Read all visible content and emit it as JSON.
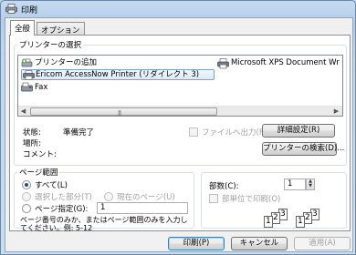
{
  "window": {
    "title": "印刷"
  },
  "tabs": [
    {
      "label": "全般"
    },
    {
      "label": "オプション"
    }
  ],
  "printer_group": {
    "label": "プリンターの選択",
    "items": [
      {
        "label": "プリンターの追加",
        "icon": "add-printer-icon"
      },
      {
        "label": "Microsoft XPS Document Wr",
        "icon": "printer-icon"
      },
      {
        "label": "Ericom AccessNow Printer (リダイレクト 3)",
        "icon": "printer-icon",
        "selected": true
      },
      {
        "label": "Fax",
        "icon": "fax-icon"
      }
    ]
  },
  "status": {
    "state_label": "状態:",
    "state_value": "準備完了",
    "location_label": "場所:",
    "comment_label": "コメント:"
  },
  "print_to_file": {
    "label": "ファイルへ出力(F)",
    "checked": false,
    "disabled": true
  },
  "buttons": {
    "preferences": "詳細設定(R)",
    "find_printer": "プリンターの検索(D)...",
    "print": "印刷(P)",
    "cancel": "キャンセル",
    "apply": "適用(A)"
  },
  "page_range": {
    "label": "ページ範囲",
    "all": "すべて(L)",
    "selection": "選択した部分(T)",
    "current_page": "現在のページ(U)",
    "pages": "ページ指定(G):",
    "pages_value": "1",
    "hint_line1": "ページ番号のみか、またはページ範囲のみを入力し",
    "hint_line2": "てください。例: 5-12"
  },
  "copies": {
    "label": "部数(C):",
    "value": "1",
    "collate": "部単位で印刷(O)",
    "collate_pages": [
      "1",
      "2",
      "3",
      "1",
      "2",
      "3"
    ]
  },
  "colors": {
    "selection_border": "#7da2ce",
    "default_button_border": "#3c7fb1",
    "radio_dot": "#1a4f8b"
  }
}
